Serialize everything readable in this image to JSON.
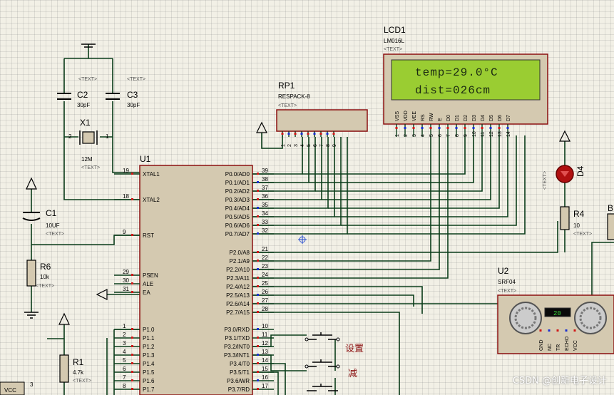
{
  "components": {
    "u1": {
      "ref": "U1"
    },
    "lcd1": {
      "ref": "LCD1",
      "part": "LM016L",
      "line1": "temp=29.0°C",
      "line2": "dist=026cm",
      "pins": [
        "VSS",
        "VDD",
        "VEE",
        "RS",
        "RW",
        "E",
        "D0",
        "D1",
        "D2",
        "D3",
        "D4",
        "D5",
        "D6",
        "D7"
      ],
      "pin_numbers": [
        "1",
        "2",
        "3",
        "4",
        "5",
        "6",
        "7",
        "8",
        "9",
        "10",
        "11",
        "12",
        "13",
        "14"
      ]
    },
    "rp1": {
      "ref": "RP1",
      "part": "RESPACK-8",
      "pin_numbers": [
        "1",
        "2",
        "3",
        "4",
        "5",
        "6",
        "7",
        "8",
        "9"
      ]
    },
    "c1": {
      "ref": "C1",
      "value": "10UF"
    },
    "c2": {
      "ref": "C2",
      "value": "30pF"
    },
    "c3": {
      "ref": "C3",
      "value": "30pF"
    },
    "x1": {
      "ref": "X1",
      "value": "12M",
      "pin1": "1",
      "pin2": "2"
    },
    "r1": {
      "ref": "R1",
      "value": "4.7k"
    },
    "r4": {
      "ref": "R4",
      "value": "10"
    },
    "r6": {
      "ref": "R6",
      "value": "10k"
    },
    "d4": {
      "ref": "D4"
    },
    "u2": {
      "ref": "U2",
      "part": "SRF04",
      "display": "20",
      "pins": [
        "GND",
        "NC",
        "TR",
        "ECHO",
        "VCC"
      ]
    },
    "vcc": {
      "label": "VCC"
    },
    "b_partial": {
      "label": "B"
    }
  },
  "text_placeholder": "<TEXT>",
  "mcu_left_pins": [
    {
      "num": "19",
      "name": "XTAL1"
    },
    {
      "num": "18",
      "name": "XTAL2"
    },
    {
      "num": "9",
      "name": "RST"
    },
    {
      "num": "29",
      "name": "PSEN"
    },
    {
      "num": "30",
      "name": "ALE"
    },
    {
      "num": "31",
      "name": "EA"
    },
    {
      "num": "1",
      "name": "P1.0"
    },
    {
      "num": "2",
      "name": "P1.1"
    },
    {
      "num": "3",
      "name": "P1.2"
    },
    {
      "num": "4",
      "name": "P1.3"
    },
    {
      "num": "5",
      "name": "P1.4"
    },
    {
      "num": "6",
      "name": "P1.5"
    },
    {
      "num": "7",
      "name": "P1.6"
    },
    {
      "num": "8",
      "name": "P1.7"
    }
  ],
  "mcu_right_pins": [
    {
      "num": "39",
      "name": "P0.0/AD0"
    },
    {
      "num": "38",
      "name": "P0.1/AD1"
    },
    {
      "num": "37",
      "name": "P0.2/AD2"
    },
    {
      "num": "36",
      "name": "P0.3/AD3"
    },
    {
      "num": "35",
      "name": "P0.4/AD4"
    },
    {
      "num": "34",
      "name": "P0.5/AD5"
    },
    {
      "num": "33",
      "name": "P0.6/AD6"
    },
    {
      "num": "32",
      "name": "P0.7/AD7"
    },
    {
      "num": "21",
      "name": "P2.0/A8"
    },
    {
      "num": "22",
      "name": "P2.1/A9"
    },
    {
      "num": "23",
      "name": "P2.2/A10"
    },
    {
      "num": "24",
      "name": "P2.3/A11"
    },
    {
      "num": "25",
      "name": "P2.4/A12"
    },
    {
      "num": "26",
      "name": "P2.5/A13"
    },
    {
      "num": "27",
      "name": "P2.6/A14"
    },
    {
      "num": "28",
      "name": "P2.7/A15"
    },
    {
      "num": "10",
      "name": "P3.0/RXD"
    },
    {
      "num": "11",
      "name": "P3.1/TXD"
    },
    {
      "num": "12",
      "name": "P3.2/INT0"
    },
    {
      "num": "13",
      "name": "P3.3/INT1"
    },
    {
      "num": "14",
      "name": "P3.4/T0"
    },
    {
      "num": "15",
      "name": "P3.5/T1"
    },
    {
      "num": "16",
      "name": "P3.6/WR"
    },
    {
      "num": "17",
      "name": "P3.7/RD"
    }
  ],
  "buttons": [
    {
      "label": "设置"
    },
    {
      "label": "减"
    }
  ],
  "watermark": "CSDN @创新电子设计",
  "colors": {
    "wire": "#0b3d1a",
    "body": "#d4c9b0",
    "lcd_screen": "#9acd32",
    "component_outline": "#8b1010",
    "led": "#b01010",
    "pin_dot_red": "#d01818",
    "pin_dot_blue": "#1a2fd0"
  }
}
